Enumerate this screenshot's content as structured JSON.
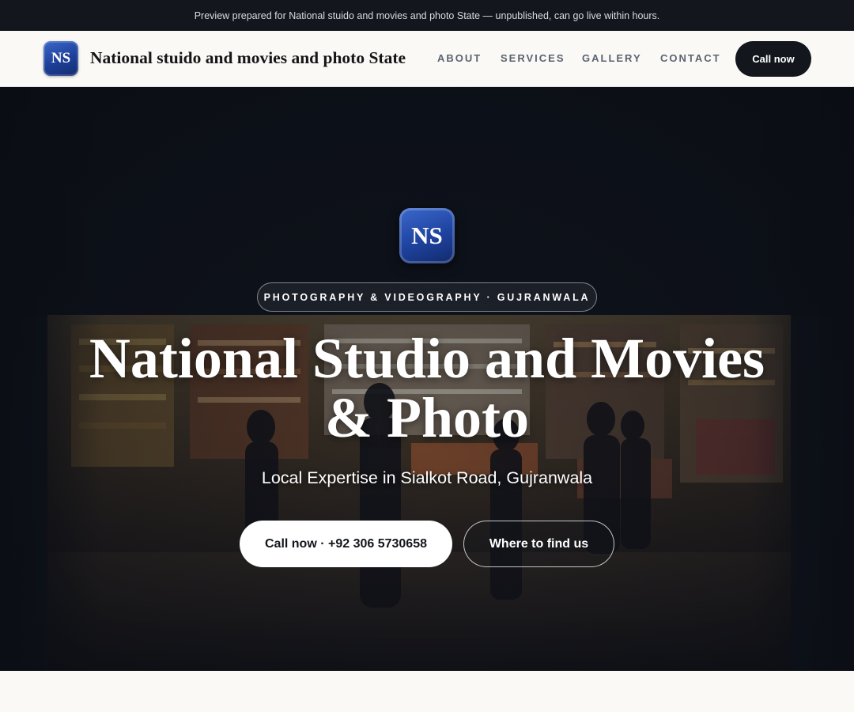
{
  "preview_banner": {
    "text": "Preview prepared for National stuido and movies and photo State — unpublished, can go live within hours."
  },
  "nav": {
    "logo_initials": "NS",
    "brand_name": "National stuido and movies and photo State",
    "links": [
      "ABOUT",
      "SERVICES",
      "GALLERY",
      "CONTACT"
    ],
    "cta_label": "Call now"
  },
  "hero": {
    "logo_initials": "NS",
    "eyebrow": "PHOTOGRAPHY & VIDEOGRAPHY · GUJRANWALA",
    "title": "National Studio and Movies & Photo",
    "subtitle": "Local Expertise in Sialkot Road, Gujranwala",
    "primary_button": "Call now · +92 306 5730658",
    "secondary_button": "Where to find us",
    "background_image": "night-market-shop-photo"
  },
  "colors": {
    "dark": "#13161c",
    "logo_blue": "#1d3f98",
    "page_background": "#faf9f6",
    "nav_link": "#5b6472"
  }
}
